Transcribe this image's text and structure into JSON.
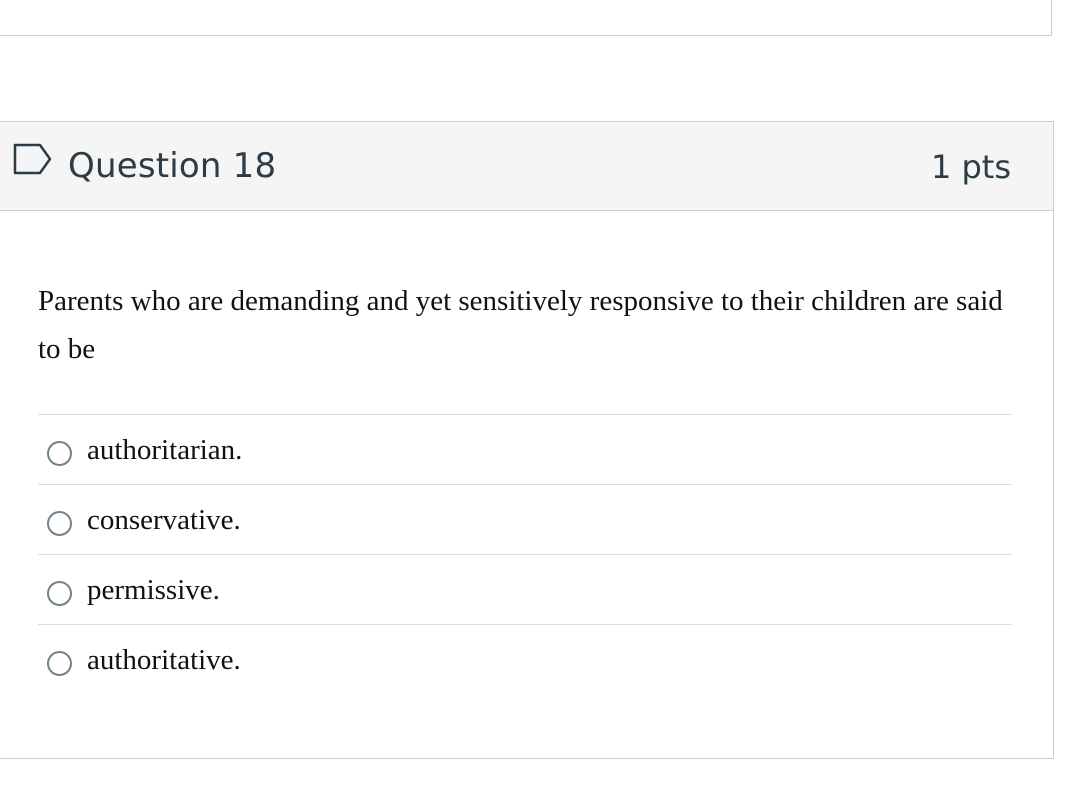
{
  "question": {
    "title": "Question 18",
    "points": "1 pts",
    "flag_icon": "flag-outline-icon",
    "text": "Parents who are demanding and yet sensitively responsive to their children are said to be",
    "answers": [
      {
        "label": "authoritarian.",
        "selected": false
      },
      {
        "label": "conservative.",
        "selected": false
      },
      {
        "label": "permissive.",
        "selected": false
      },
      {
        "label": "authoritative.",
        "selected": false
      }
    ]
  },
  "colors": {
    "header_bg": "#f5f5f5",
    "border": "#c7cdd1",
    "text": "#2d3b45",
    "radio_border": "#73818a"
  }
}
